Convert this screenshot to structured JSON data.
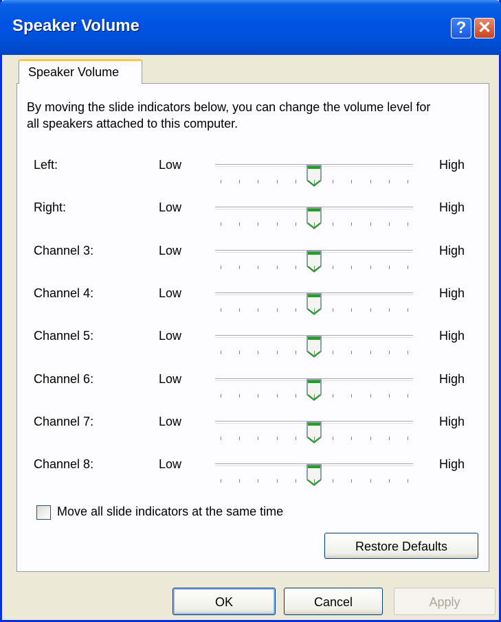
{
  "window": {
    "title": "Speaker Volume"
  },
  "titlebar": {
    "help_glyph": "?",
    "close_glyph": "✕"
  },
  "tab": {
    "label": "Speaker Volume"
  },
  "description": "By moving the slide indicators below, you can change the volume level for all speakers attached to this computer.",
  "sliders": [
    {
      "name": "Left:",
      "low": "Low",
      "high": "High",
      "value": 0.5
    },
    {
      "name": "Right:",
      "low": "Low",
      "high": "High",
      "value": 0.5
    },
    {
      "name": "Channel 3:",
      "low": "Low",
      "high": "High",
      "value": 0.5
    },
    {
      "name": "Channel 4:",
      "low": "Low",
      "high": "High",
      "value": 0.5
    },
    {
      "name": "Channel 5:",
      "low": "Low",
      "high": "High",
      "value": 0.5
    },
    {
      "name": "Channel 6:",
      "low": "Low",
      "high": "High",
      "value": 0.5
    },
    {
      "name": "Channel 7:",
      "low": "Low",
      "high": "High",
      "value": 0.5
    },
    {
      "name": "Channel 8:",
      "low": "Low",
      "high": "High",
      "value": 0.5
    }
  ],
  "tick_count": 11,
  "sync_checkbox": {
    "label": "Move all slide indicators at the same time",
    "checked": false
  },
  "buttons": {
    "restore": "Restore Defaults",
    "ok": "OK",
    "cancel": "Cancel",
    "apply": "Apply"
  },
  "colors": {
    "title_bar": "#0054e3",
    "tab_accent": "#ffc83c",
    "thumb_accent": "#21a121",
    "dialog_bg": "#ece9d8"
  }
}
